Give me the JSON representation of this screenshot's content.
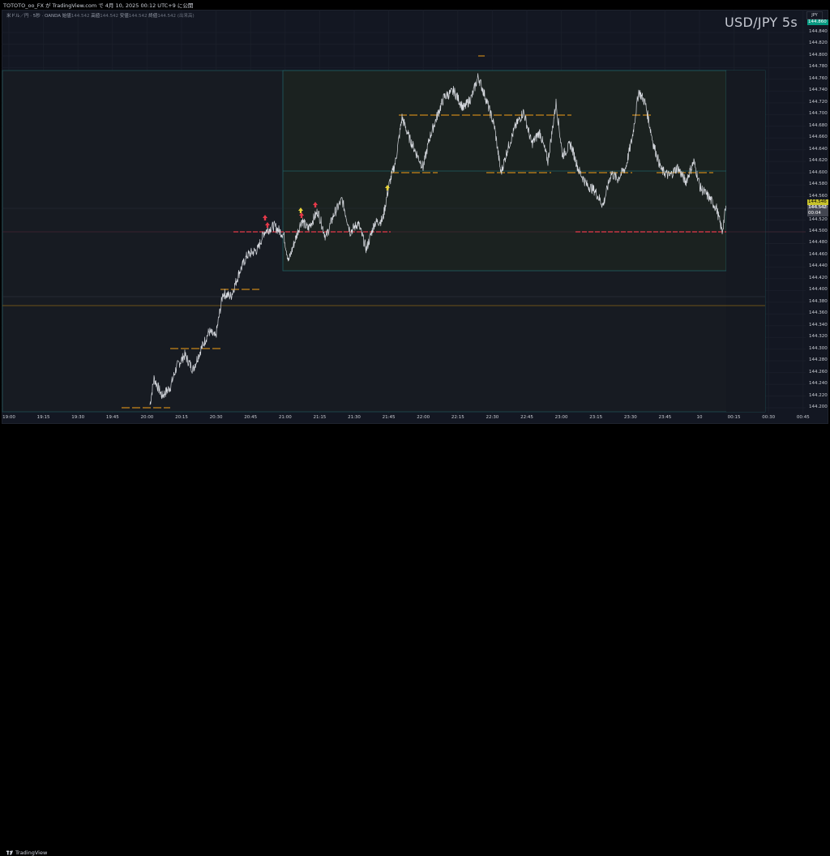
{
  "header": {
    "title": "TOTOTO_oo_FX が TradingView.com で 4月 10, 2025 00:12 UTC+9 に公開",
    "symbol_desc": "米ドル／円 · 5秒 · OANDA",
    "ohlc": [
      {
        "label": "始値",
        "value": "144.542"
      },
      {
        "label": "高値",
        "value": "144.542"
      },
      {
        "label": "安値",
        "value": "144.542"
      },
      {
        "label": "終値",
        "value": "144.542"
      }
    ],
    "change": "(出来高)"
  },
  "watermark": "USD/JPY 5s",
  "price_axis": {
    "currency": "JPY",
    "labels": [
      "144.840",
      "144.820",
      "144.800",
      "144.780",
      "144.760",
      "144.740",
      "144.720",
      "144.700",
      "144.680",
      "144.660",
      "144.640",
      "144.620",
      "144.600",
      "144.580",
      "144.560",
      "144.540",
      "144.520",
      "144.500",
      "144.480",
      "144.460",
      "144.440",
      "144.420",
      "144.400",
      "144.380",
      "144.360",
      "144.340",
      "144.320",
      "144.300",
      "144.280",
      "144.260",
      "144.240",
      "144.220",
      "144.200"
    ],
    "top_tag": "144.860",
    "last_price_tag": "144.546",
    "bid_tag": "144.542",
    "countdown_tag": "00:04"
  },
  "time_axis": {
    "labels": [
      "19:00",
      "19:15",
      "19:30",
      "19:45",
      "20:00",
      "20:15",
      "20:30",
      "20:45",
      "21:00",
      "21:15",
      "21:30",
      "21:45",
      "22:00",
      "22:15",
      "22:30",
      "22:45",
      "23:00",
      "23:15",
      "23:30",
      "23:45",
      "10",
      "00:15",
      "00:30",
      "00:45"
    ]
  },
  "footer": {
    "brand": "TradingView"
  },
  "colors": {
    "background": "#131722",
    "candle": "#d1d4dc",
    "level_orange": "#c8861a",
    "level_red": "#e5394a",
    "box_border": "#1f5f63",
    "up_marker": "#e8d43a",
    "down_marker": "#e5394a",
    "last_price_bg": "#c7c32c",
    "top_tag_bg": "#089981"
  }
}
